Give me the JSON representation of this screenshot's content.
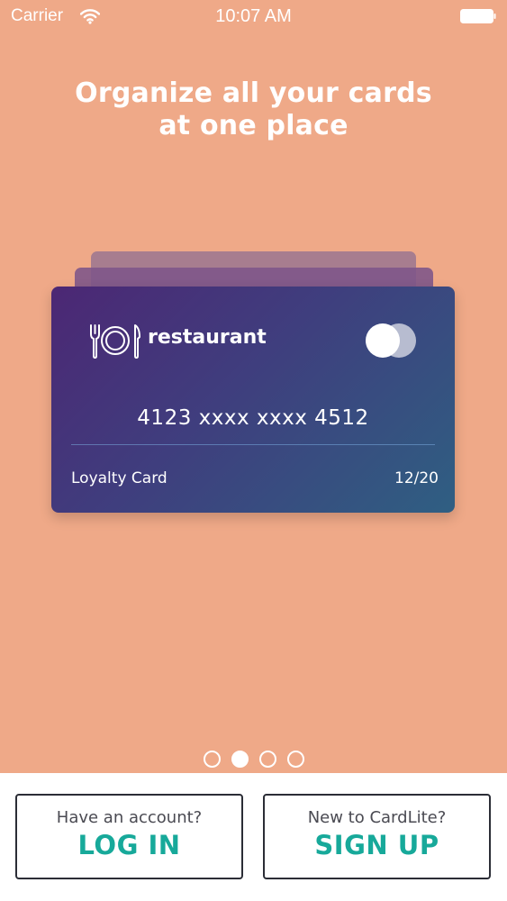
{
  "status_bar": {
    "carrier": "Carrier",
    "time": "10:07 AM",
    "wifi_icon": "wifi-icon",
    "battery_icon": "battery-icon"
  },
  "headline": {
    "line1": "Organize all your cards",
    "line2": "at one place"
  },
  "card": {
    "brand_name": "restaurant",
    "brand_icon": "plate-cutlery-icon",
    "toggle_icon": "card-toggle-icon",
    "number": "4123 xxxx xxxx 4512",
    "type_label": "Loyalty Card",
    "expiry": "12/20"
  },
  "pagination": {
    "total": 4,
    "active_index": 1
  },
  "auth": {
    "login_prompt": "Have an account?",
    "login_label": "LOG IN",
    "signup_prompt": "New to CardLite?",
    "signup_label": "SIGN UP"
  },
  "colors": {
    "background": "#EFA988",
    "accent": "#17A99A",
    "card_start": "#4C2774",
    "card_end": "#2F5F82"
  }
}
